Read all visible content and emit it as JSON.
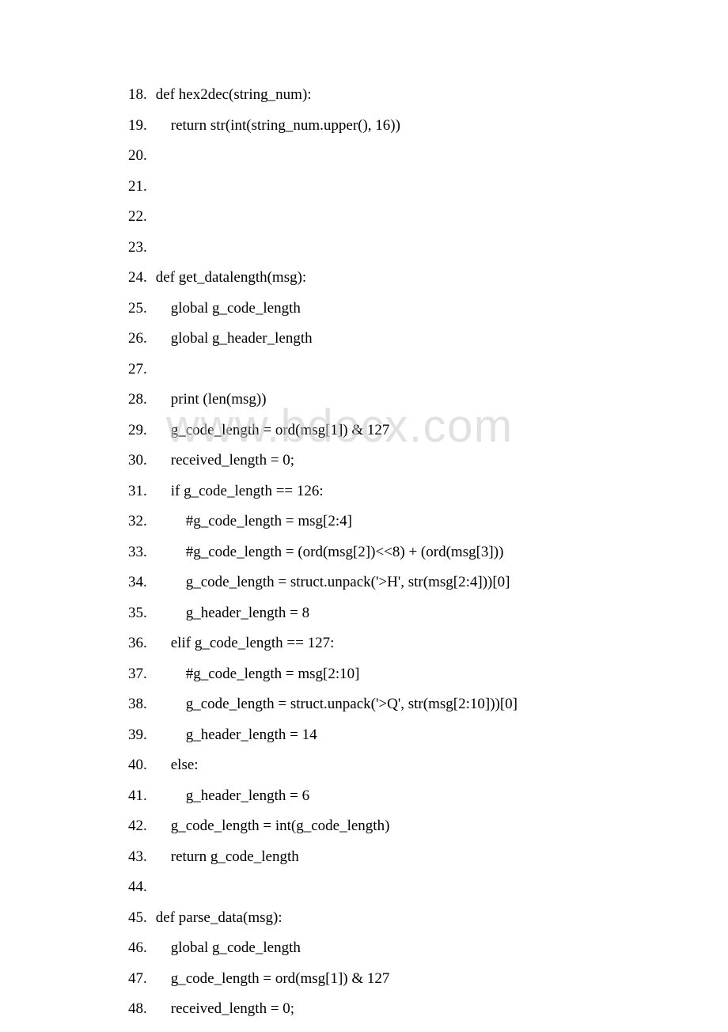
{
  "watermark": "www.bdocx.com",
  "lines": [
    {
      "n": "18.",
      "prefix": " ",
      "code": "def hex2dec(string_num):"
    },
    {
      "n": "19.",
      "prefix": "     ",
      "code": "return str(int(string_num.upper(), 16))"
    },
    {
      "n": "20.",
      "prefix": "",
      "code": ""
    },
    {
      "n": "21.",
      "prefix": "",
      "code": ""
    },
    {
      "n": "22.",
      "prefix": "",
      "code": ""
    },
    {
      "n": "23.",
      "prefix": "",
      "code": ""
    },
    {
      "n": "24.",
      "prefix": " ",
      "code": "def get_datalength(msg):"
    },
    {
      "n": "25.",
      "prefix": "     ",
      "code": "global g_code_length"
    },
    {
      "n": "26.",
      "prefix": "     ",
      "code": "global g_header_length"
    },
    {
      "n": "27.",
      "prefix": "",
      "code": ""
    },
    {
      "n": "28.",
      "prefix": "     ",
      "code": "print (len(msg))"
    },
    {
      "n": "29.",
      "prefix": "     ",
      "code": "g_code_length = ord(msg[1]) & 127"
    },
    {
      "n": "30.",
      "prefix": "     ",
      "code": "received_length = 0;"
    },
    {
      "n": "31.",
      "prefix": "     ",
      "code": "if g_code_length == 126:"
    },
    {
      "n": "32.",
      "prefix": "         ",
      "code": "#g_code_length = msg[2:4]"
    },
    {
      "n": "33.",
      "prefix": "         ",
      "code": "#g_code_length = (ord(msg[2])<<8) + (ord(msg[3]))"
    },
    {
      "n": "34.",
      "prefix": "         ",
      "code": "g_code_length = struct.unpack('>H', str(msg[2:4]))[0]"
    },
    {
      "n": "35.",
      "prefix": "         ",
      "code": "g_header_length = 8"
    },
    {
      "n": "36.",
      "prefix": "     ",
      "code": "elif g_code_length == 127:"
    },
    {
      "n": "37.",
      "prefix": "         ",
      "code": "#g_code_length = msg[2:10]"
    },
    {
      "n": "38.",
      "prefix": "         ",
      "code": "g_code_length = struct.unpack('>Q', str(msg[2:10]))[0]"
    },
    {
      "n": "39.",
      "prefix": "         ",
      "code": "g_header_length = 14"
    },
    {
      "n": "40.",
      "prefix": "     ",
      "code": "else:"
    },
    {
      "n": "41.",
      "prefix": "         ",
      "code": "g_header_length = 6"
    },
    {
      "n": "42.",
      "prefix": "     ",
      "code": "g_code_length = int(g_code_length)"
    },
    {
      "n": "43.",
      "prefix": "     ",
      "code": "return g_code_length"
    },
    {
      "n": "44.",
      "prefix": "",
      "code": ""
    },
    {
      "n": "45.",
      "prefix": " ",
      "code": "def parse_data(msg):"
    },
    {
      "n": "46.",
      "prefix": "     ",
      "code": "global g_code_length"
    },
    {
      "n": "47.",
      "prefix": "     ",
      "code": "g_code_length = ord(msg[1]) & 127"
    },
    {
      "n": "48.",
      "prefix": "     ",
      "code": "received_length = 0;"
    }
  ]
}
